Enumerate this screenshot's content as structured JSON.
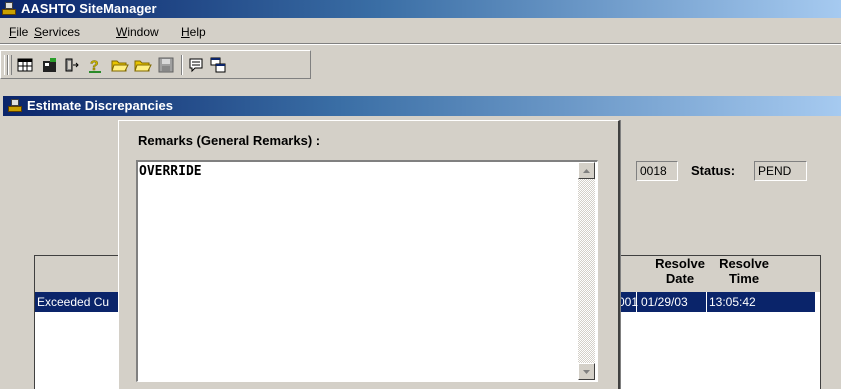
{
  "app": {
    "title": "AASHTO SiteManager"
  },
  "menu": [
    {
      "label": "File",
      "u": "F",
      "rest": "ile"
    },
    {
      "label": "Services",
      "u": "S",
      "rest": "ervices"
    },
    {
      "label": "Window",
      "u": "W",
      "rest": "indow"
    },
    {
      "label": "Help",
      "u": "H",
      "rest": "elp"
    }
  ],
  "toolbar": {
    "icons": [
      "table-icon",
      "camera-icon",
      "exit-icon",
      "help-icon",
      "open-folder-icon",
      "open-folder-icon",
      "save-icon",
      "comment-icon",
      "window-tile-icon"
    ]
  },
  "window": {
    "title": "Estimate Discrepancies"
  },
  "form": {
    "id_field": "0018",
    "status_label": "Status:",
    "status_value": "PEND"
  },
  "grid": {
    "columns": [
      {
        "label": "Resolve\nDate"
      },
      {
        "label": "Resolve\nTime"
      }
    ],
    "selected_row": {
      "description": "Exceeded Cu",
      "partial": "001",
      "resolve_date": "01/29/03",
      "resolve_time": "13:05:42"
    }
  },
  "dialog": {
    "label": "Remarks (General Remarks) :",
    "remarks_text": "OVERRIDE"
  },
  "colors": {
    "title_bar": "#0a246a",
    "selection": "#0a246a",
    "face": "#d4d0c8"
  }
}
